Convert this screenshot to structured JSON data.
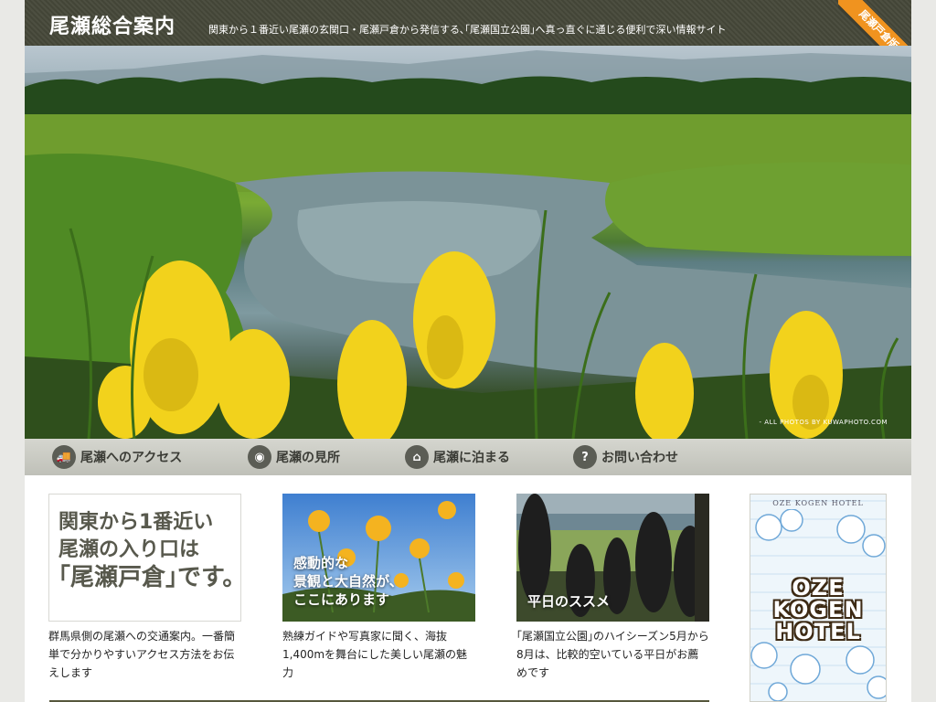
{
  "header": {
    "site_title": "尾瀬総合案内",
    "tagline": "関東から１番近い尾瀬の玄関口・尾瀬戸倉から発信する､｢尾瀬国立公園｣へ真っ直ぐに通じる便利で深い情報サイト",
    "ribbon": "尾瀬戸倉版"
  },
  "hero": {
    "credit": "- ALL PHOTOS BY KUWAPHOTO.COM"
  },
  "nav": {
    "items": [
      {
        "label": "尾瀬へのアクセス",
        "icon": "truck-icon",
        "glyph": "🚚"
      },
      {
        "label": "尾瀬の見所",
        "icon": "camera-icon",
        "glyph": "◉"
      },
      {
        "label": "尾瀬に泊まる",
        "icon": "house-icon",
        "glyph": "⌂"
      },
      {
        "label": "お問い合わせ",
        "icon": "question-icon",
        "glyph": "?"
      }
    ]
  },
  "content": {
    "promo": {
      "line1": "関東から1番近い",
      "line2": "尾瀬の入り口は",
      "line3": "｢尾瀬戸倉｣です。"
    },
    "col1_desc": "群馬県側の尾瀬への交通案内。一番簡単で分かりやすいアクセス方法をお伝えします",
    "col2": {
      "caption_line1": "感動的な",
      "caption_line2": "景観と大自然が、",
      "caption_line3": "ここにあります",
      "desc": "熟練ガイドや写真家に聞く、海抜1,400mを舞台にした美しい尾瀬の魅力"
    },
    "col3": {
      "caption": "平日のススメ",
      "desc": "｢尾瀬国立公園｣のハイシーズン5月から8月は、比較的空いている平日がお薦めです"
    },
    "ad": {
      "title": "OZE KOGEN HOTEL",
      "logo_line1": "OZE",
      "logo_line2": "KOGEN",
      "logo_line3": "HOTEL"
    }
  },
  "colors": {
    "header_bg": "#464839",
    "ribbon": "#f0931f",
    "nav_bg": "#c6c7c0",
    "nav_text": "#3b3c36",
    "promo_text": "#58594d"
  }
}
